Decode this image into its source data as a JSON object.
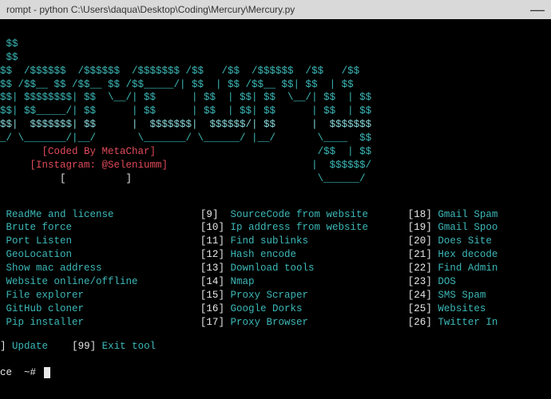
{
  "titlebar": {
    "title": "rompt - python  C:\\Users\\daqua\\Desktop\\Coding\\Mercury\\Mercury.py",
    "minimize": "—"
  },
  "ascii": {
    "l1": " $$",
    "l2": " $$",
    "l3": "$$  /$$$$$$  /$$$$$$  /$$$$$$$ /$$   /$$  /$$$$$$  /$$   /$$",
    "l4": "$$ /$$__ $$ /$$__ $$ /$$_____/| $$  | $$ /$$__ $$| $$  | $$",
    "l5": "$$| $$$$$$$$| $$  \\__/| $$      | $$  | $$| $$  \\__/| $$  | $$",
    "l6": "$$| $$_____/| $$      | $$      | $$  | $$| $$      | $$  | $$",
    "l7": "$$|  $$$$$$$| $$      |  $$$$$$$|  $$$$$$/| $$      |  $$$$$$$",
    "l8": "_/ \\_______/|__/       \\_______/ \\______/ |__/       \\____  $$",
    "l9a": "       [Coded By MetaChar]",
    "l9b": "                           /$$  | $$",
    "l10a": "     [Instagram: @Seleniumm]",
    "l10b": "                        |  $$$$$$/",
    "l11a": "          [          ]",
    "l11b": "                               \\______/"
  },
  "menu": {
    "col1": [
      {
        "label": "ReadMe and license"
      },
      {
        "label": "Brute force"
      },
      {
        "label": "Port Listen"
      },
      {
        "label": "GeoLocation"
      },
      {
        "label": "Show mac address"
      },
      {
        "label": "Website online/offline"
      },
      {
        "label": "File explorer"
      },
      {
        "label": "GitHub cloner"
      },
      {
        "label": "Pip installer"
      }
    ],
    "col2": [
      {
        "num": "9",
        "label": "SourceCode from website"
      },
      {
        "num": "10",
        "label": "Ip address from website"
      },
      {
        "num": "11",
        "label": "Find sublinks"
      },
      {
        "num": "12",
        "label": "Hash encode"
      },
      {
        "num": "13",
        "label": "Download tools"
      },
      {
        "num": "14",
        "label": "Nmap"
      },
      {
        "num": "15",
        "label": "Proxy Scraper"
      },
      {
        "num": "16",
        "label": "Google Dorks"
      },
      {
        "num": "17",
        "label": "Proxy Browser"
      }
    ],
    "col3": [
      {
        "num": "18",
        "label": "Gmail Spam"
      },
      {
        "num": "19",
        "label": "Gmail Spoo"
      },
      {
        "num": "20",
        "label": "Does Site"
      },
      {
        "num": "21",
        "label": "Hex decode"
      },
      {
        "num": "22",
        "label": "Find Admin"
      },
      {
        "num": "23",
        "label": "DOS"
      },
      {
        "num": "24",
        "label": "SMS Spam"
      },
      {
        "num": "25",
        "label": "Websites"
      },
      {
        "num": "26",
        "label": "Twitter In"
      }
    ]
  },
  "footer": {
    "update_bracket": "]",
    "update_label": "Update",
    "exit_num": "99",
    "exit_label": "Exit tool"
  },
  "prompt": {
    "text": "ce  ~# "
  }
}
